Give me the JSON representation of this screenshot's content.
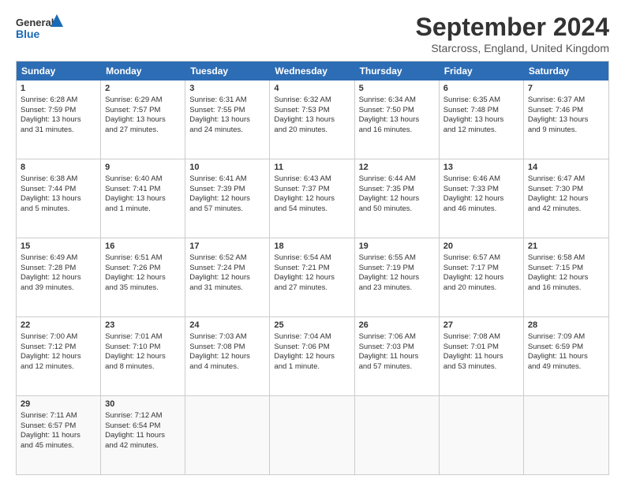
{
  "header": {
    "logo_line1": "General",
    "logo_line2": "Blue",
    "title": "September 2024",
    "subtitle": "Starcross, England, United Kingdom"
  },
  "weekdays": [
    "Sunday",
    "Monday",
    "Tuesday",
    "Wednesday",
    "Thursday",
    "Friday",
    "Saturday"
  ],
  "weeks": [
    [
      {
        "day": 1,
        "lines": [
          "Sunrise: 6:28 AM",
          "Sunset: 7:59 PM",
          "Daylight: 13 hours",
          "and 31 minutes."
        ]
      },
      {
        "day": 2,
        "lines": [
          "Sunrise: 6:29 AM",
          "Sunset: 7:57 PM",
          "Daylight: 13 hours",
          "and 27 minutes."
        ]
      },
      {
        "day": 3,
        "lines": [
          "Sunrise: 6:31 AM",
          "Sunset: 7:55 PM",
          "Daylight: 13 hours",
          "and 24 minutes."
        ]
      },
      {
        "day": 4,
        "lines": [
          "Sunrise: 6:32 AM",
          "Sunset: 7:53 PM",
          "Daylight: 13 hours",
          "and 20 minutes."
        ]
      },
      {
        "day": 5,
        "lines": [
          "Sunrise: 6:34 AM",
          "Sunset: 7:50 PM",
          "Daylight: 13 hours",
          "and 16 minutes."
        ]
      },
      {
        "day": 6,
        "lines": [
          "Sunrise: 6:35 AM",
          "Sunset: 7:48 PM",
          "Daylight: 13 hours",
          "and 12 minutes."
        ]
      },
      {
        "day": 7,
        "lines": [
          "Sunrise: 6:37 AM",
          "Sunset: 7:46 PM",
          "Daylight: 13 hours",
          "and 9 minutes."
        ]
      }
    ],
    [
      {
        "day": 8,
        "lines": [
          "Sunrise: 6:38 AM",
          "Sunset: 7:44 PM",
          "Daylight: 13 hours",
          "and 5 minutes."
        ]
      },
      {
        "day": 9,
        "lines": [
          "Sunrise: 6:40 AM",
          "Sunset: 7:41 PM",
          "Daylight: 13 hours",
          "and 1 minute."
        ]
      },
      {
        "day": 10,
        "lines": [
          "Sunrise: 6:41 AM",
          "Sunset: 7:39 PM",
          "Daylight: 12 hours",
          "and 57 minutes."
        ]
      },
      {
        "day": 11,
        "lines": [
          "Sunrise: 6:43 AM",
          "Sunset: 7:37 PM",
          "Daylight: 12 hours",
          "and 54 minutes."
        ]
      },
      {
        "day": 12,
        "lines": [
          "Sunrise: 6:44 AM",
          "Sunset: 7:35 PM",
          "Daylight: 12 hours",
          "and 50 minutes."
        ]
      },
      {
        "day": 13,
        "lines": [
          "Sunrise: 6:46 AM",
          "Sunset: 7:33 PM",
          "Daylight: 12 hours",
          "and 46 minutes."
        ]
      },
      {
        "day": 14,
        "lines": [
          "Sunrise: 6:47 AM",
          "Sunset: 7:30 PM",
          "Daylight: 12 hours",
          "and 42 minutes."
        ]
      }
    ],
    [
      {
        "day": 15,
        "lines": [
          "Sunrise: 6:49 AM",
          "Sunset: 7:28 PM",
          "Daylight: 12 hours",
          "and 39 minutes."
        ]
      },
      {
        "day": 16,
        "lines": [
          "Sunrise: 6:51 AM",
          "Sunset: 7:26 PM",
          "Daylight: 12 hours",
          "and 35 minutes."
        ]
      },
      {
        "day": 17,
        "lines": [
          "Sunrise: 6:52 AM",
          "Sunset: 7:24 PM",
          "Daylight: 12 hours",
          "and 31 minutes."
        ]
      },
      {
        "day": 18,
        "lines": [
          "Sunrise: 6:54 AM",
          "Sunset: 7:21 PM",
          "Daylight: 12 hours",
          "and 27 minutes."
        ]
      },
      {
        "day": 19,
        "lines": [
          "Sunrise: 6:55 AM",
          "Sunset: 7:19 PM",
          "Daylight: 12 hours",
          "and 23 minutes."
        ]
      },
      {
        "day": 20,
        "lines": [
          "Sunrise: 6:57 AM",
          "Sunset: 7:17 PM",
          "Daylight: 12 hours",
          "and 20 minutes."
        ]
      },
      {
        "day": 21,
        "lines": [
          "Sunrise: 6:58 AM",
          "Sunset: 7:15 PM",
          "Daylight: 12 hours",
          "and 16 minutes."
        ]
      }
    ],
    [
      {
        "day": 22,
        "lines": [
          "Sunrise: 7:00 AM",
          "Sunset: 7:12 PM",
          "Daylight: 12 hours",
          "and 12 minutes."
        ]
      },
      {
        "day": 23,
        "lines": [
          "Sunrise: 7:01 AM",
          "Sunset: 7:10 PM",
          "Daylight: 12 hours",
          "and 8 minutes."
        ]
      },
      {
        "day": 24,
        "lines": [
          "Sunrise: 7:03 AM",
          "Sunset: 7:08 PM",
          "Daylight: 12 hours",
          "and 4 minutes."
        ]
      },
      {
        "day": 25,
        "lines": [
          "Sunrise: 7:04 AM",
          "Sunset: 7:06 PM",
          "Daylight: 12 hours",
          "and 1 minute."
        ]
      },
      {
        "day": 26,
        "lines": [
          "Sunrise: 7:06 AM",
          "Sunset: 7:03 PM",
          "Daylight: 11 hours",
          "and 57 minutes."
        ]
      },
      {
        "day": 27,
        "lines": [
          "Sunrise: 7:08 AM",
          "Sunset: 7:01 PM",
          "Daylight: 11 hours",
          "and 53 minutes."
        ]
      },
      {
        "day": 28,
        "lines": [
          "Sunrise: 7:09 AM",
          "Sunset: 6:59 PM",
          "Daylight: 11 hours",
          "and 49 minutes."
        ]
      }
    ],
    [
      {
        "day": 29,
        "lines": [
          "Sunrise: 7:11 AM",
          "Sunset: 6:57 PM",
          "Daylight: 11 hours",
          "and 45 minutes."
        ]
      },
      {
        "day": 30,
        "lines": [
          "Sunrise: 7:12 AM",
          "Sunset: 6:54 PM",
          "Daylight: 11 hours",
          "and 42 minutes."
        ]
      },
      null,
      null,
      null,
      null,
      null
    ]
  ]
}
